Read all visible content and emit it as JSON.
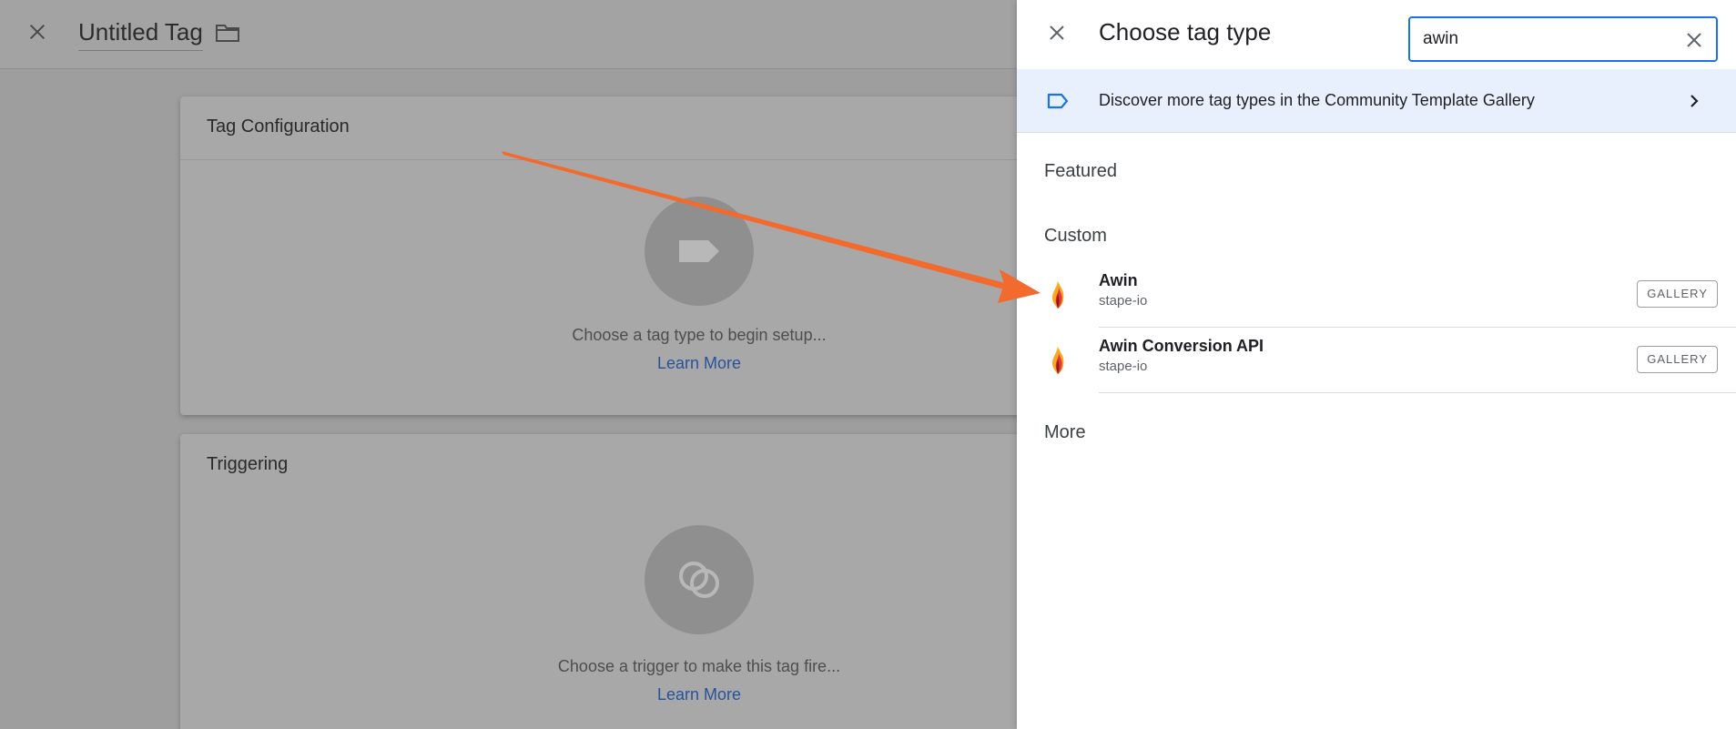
{
  "editor": {
    "tag_title": "Untitled Tag",
    "config_card": {
      "title": "Tag Configuration",
      "hint": "Choose a tag type to begin setup...",
      "learn_more": "Learn More"
    },
    "trigger_card": {
      "title": "Triggering",
      "hint": "Choose a trigger to make this tag fire...",
      "learn_more": "Learn More"
    }
  },
  "panel": {
    "title": "Choose tag type",
    "search": {
      "value": "awin",
      "placeholder": ""
    },
    "discover_label": "Discover more tag types in the Community Template Gallery",
    "sections": {
      "featured": "Featured",
      "custom": "Custom",
      "more": "More"
    },
    "items": [
      {
        "name": "Awin",
        "vendor": "stape-io",
        "badge": "GALLERY"
      },
      {
        "name": "Awin Conversion API",
        "vendor": "stape-io",
        "badge": "GALLERY"
      }
    ]
  },
  "colors": {
    "accent": "#1a73e8",
    "discover_bg": "#e8f0fe",
    "arrow": "#f26a2e",
    "overlay": "#9e9e9e"
  },
  "icons": [
    "close-icon",
    "folder-icon",
    "tag-icon",
    "trigger-icon",
    "chevron-right-icon",
    "clear-search-icon",
    "awin-flame-icon"
  ]
}
